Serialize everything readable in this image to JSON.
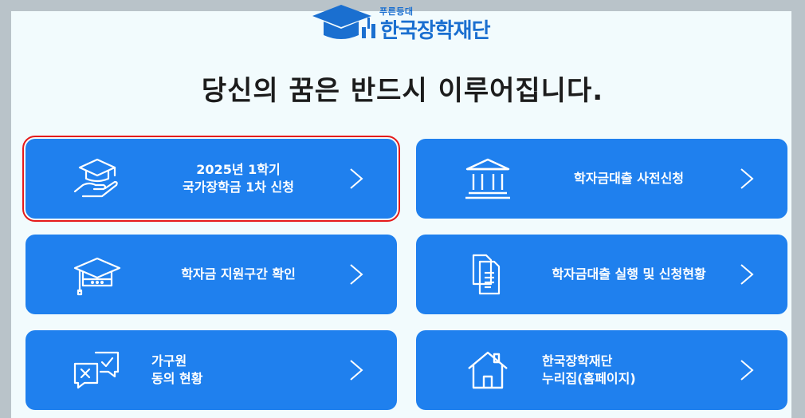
{
  "brand": {
    "tagline": "푸른등대",
    "name": "한국장학재단",
    "color": "#1a6fd0"
  },
  "headline": "당신의 꿈은 반드시 이루어집니다.",
  "accent_color": "#1f80ee",
  "cards": [
    {
      "line1": "2025년 1학기",
      "line2": "국가장학금 1차 신청",
      "icon": "graduation-hand-icon",
      "selected": true
    },
    {
      "line1": "학자금대출 사전신청",
      "line2": "",
      "icon": "bank-building-icon",
      "selected": false
    },
    {
      "line1": "학자금 지원구간 확인",
      "line2": "",
      "icon": "graduation-cap-icon",
      "selected": false
    },
    {
      "line1": "학자금대출 실행 및 신청현황",
      "line2": "",
      "icon": "documents-icon",
      "selected": false
    },
    {
      "line1": "가구원",
      "line2": "동의 현황",
      "icon": "chat-check-icon",
      "selected": false
    },
    {
      "line1": "한국장학재단",
      "line2": "누리집(홈페이지)",
      "icon": "house-icon",
      "selected": false
    }
  ]
}
